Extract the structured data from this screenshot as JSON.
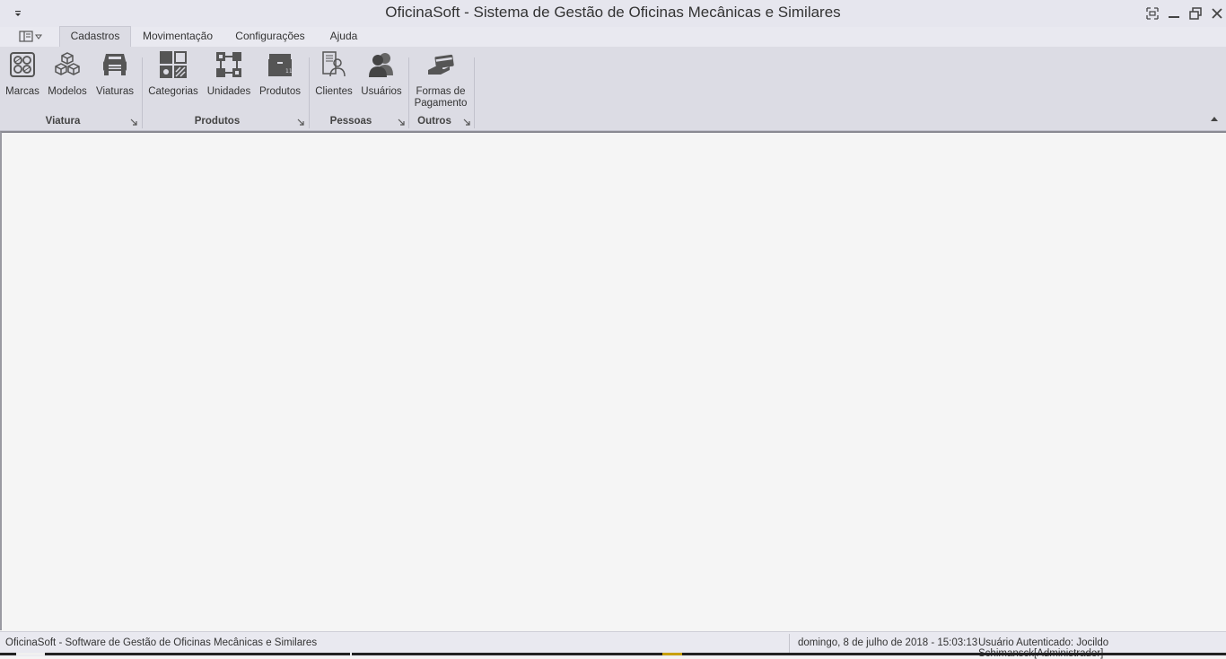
{
  "window": {
    "title": "OficinaSoft - Sistema de Gestão de Oficinas Mecânicas e Similares"
  },
  "tabs": [
    {
      "label": "Cadastros",
      "active": true
    },
    {
      "label": "Movimentação",
      "active": false
    },
    {
      "label": "Configurações",
      "active": false
    },
    {
      "label": "Ajuda",
      "active": false
    }
  ],
  "ribbon": {
    "groups": [
      {
        "label": "Viatura",
        "buttons": [
          {
            "label": "Marcas",
            "icon": "brands-icon"
          },
          {
            "label": "Modelos",
            "icon": "cubes-icon"
          },
          {
            "label": "Viaturas",
            "icon": "car-icon"
          }
        ]
      },
      {
        "label": "Produtos",
        "buttons": [
          {
            "label": "Categorias",
            "icon": "categories-icon"
          },
          {
            "label": "Unidades",
            "icon": "units-icon"
          },
          {
            "label": "Produtos",
            "icon": "box-icon"
          }
        ]
      },
      {
        "label": "Pessoas",
        "buttons": [
          {
            "label": "Clientes",
            "icon": "clients-icon"
          },
          {
            "label": "Usuários",
            "icon": "users-icon"
          }
        ]
      },
      {
        "label": "Outros",
        "buttons": [
          {
            "label": "Formas de Pagamento",
            "label_line1": "Formas de",
            "label_line2": "Pagamento",
            "icon": "payment-card-icon"
          }
        ]
      }
    ]
  },
  "statusbar": {
    "app_text": "OficinaSoft - Software de Gestão de Oficinas Mecânicas e Similares",
    "datetime": "domingo, 8 de julho de 2018 - 15:03:13",
    "user": "Usuário Autenticado: Jocildo Schimansck[Administrador]"
  },
  "colors": {
    "ribbon_bg": "#dcdce4",
    "titlebar_bg": "#e6e6ee",
    "workspace_bg": "#f5f5f5",
    "icon_gray": "#555555"
  }
}
